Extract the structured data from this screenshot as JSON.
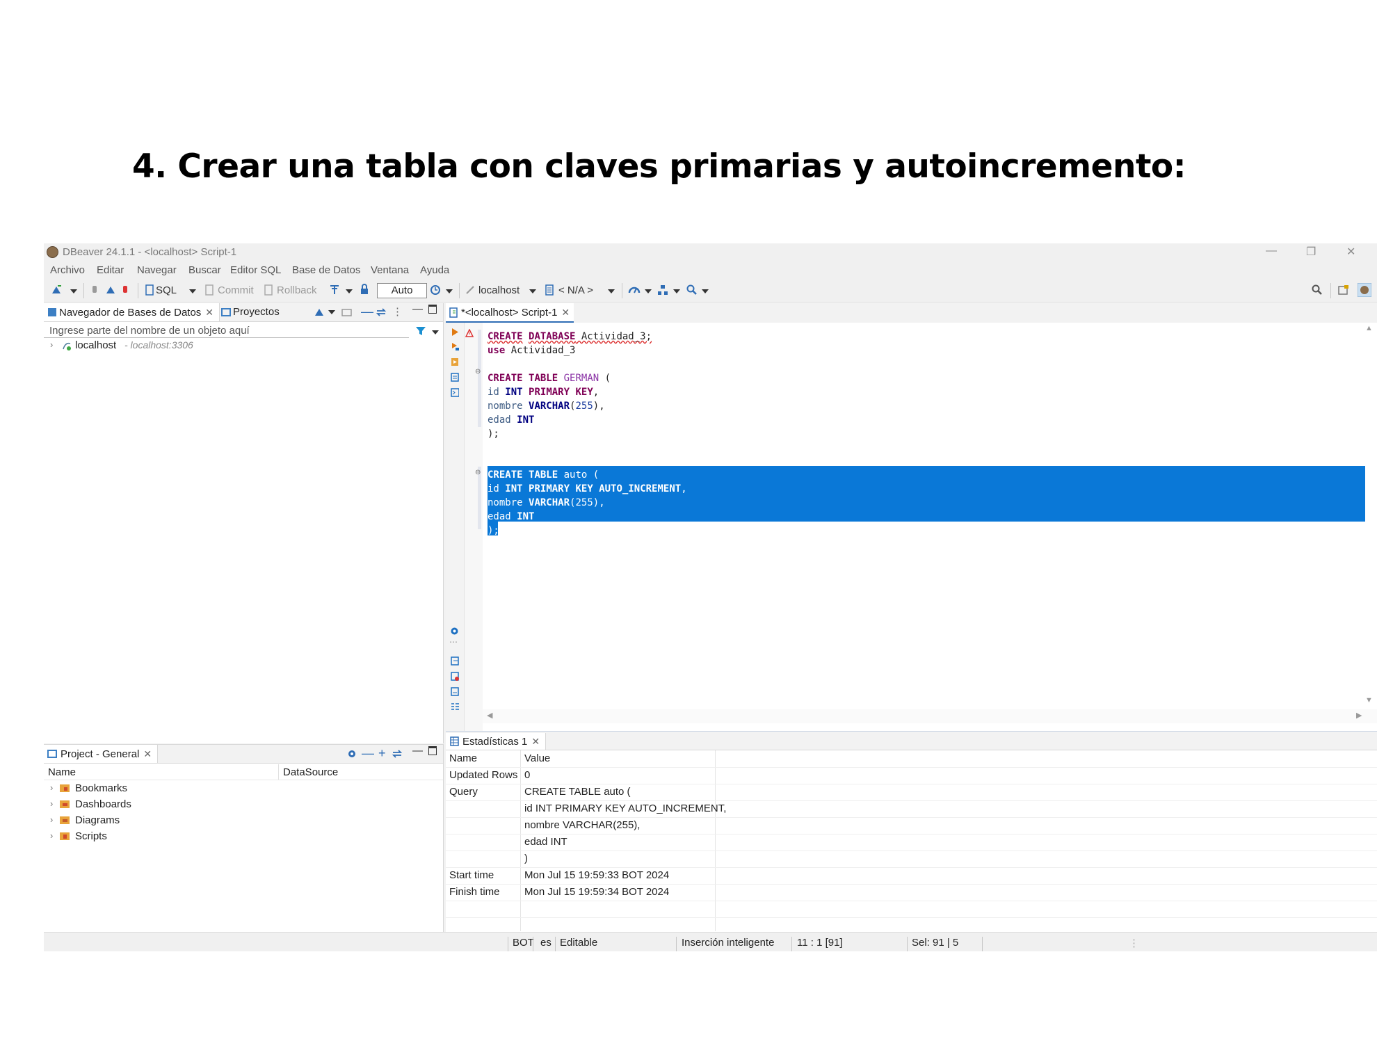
{
  "slide": {
    "title": "4. Crear una tabla con claves primarias y autoincremento:"
  },
  "window": {
    "title": "DBeaver 24.1.1 - <localhost> Script-1",
    "menu": [
      "Archivo",
      "Editar",
      "Navegar",
      "Buscar",
      "Editor SQL",
      "Base de Datos",
      "Ventana",
      "Ayuda"
    ]
  },
  "toolbar": {
    "sql_label": "SQL",
    "commit_label": "Commit",
    "rollback_label": "Rollback",
    "transaction_mode": "Auto",
    "datasource": "localhost",
    "schema": "< N/A >"
  },
  "navigator": {
    "tab_db": "Navegador de Bases de Datos",
    "tab_projects": "Proyectos",
    "filter_placeholder": "Ingrese parte del nombre de un objeto aquí",
    "connection_name": "localhost",
    "connection_host": " - localhost:3306"
  },
  "project": {
    "tab": "Project - General",
    "col_name": "Name",
    "col_datasource": "DataSource",
    "items": [
      "Bookmarks",
      "Dashboards",
      "Diagrams",
      "Scripts"
    ]
  },
  "editor": {
    "tab": "*<localhost> Script-1"
  },
  "results": {
    "tab": "Estadísticas 1",
    "headers": [
      "Name",
      "Value"
    ],
    "rows": [
      [
        "Updated Rows",
        "0"
      ],
      [
        "Query",
        "CREATE TABLE auto ("
      ],
      [
        "",
        "id INT PRIMARY KEY AUTO_INCREMENT,"
      ],
      [
        "",
        "nombre VARCHAR(255),"
      ],
      [
        "",
        "edad INT"
      ],
      [
        "",
        ")"
      ],
      [
        "Start time",
        "Mon Jul 15 19:59:33 BOT 2024"
      ],
      [
        "Finish time",
        "Mon Jul 15 19:59:34 BOT 2024"
      ]
    ]
  },
  "status": {
    "timezone": "BOT",
    "locale": "es",
    "mode": "Editable",
    "insert_mode": "Inserción inteligente",
    "position": "11 : 1 [91]",
    "selection": "Sel: 91 | 5"
  },
  "code": {
    "l1_create": "CREATE",
    "l1_database": "DATABASE",
    "l1_name": " Actividad_3;",
    "l2_use": "use",
    "l2_name": " Actividad_3",
    "t1_create": "CREATE",
    "t1_table": "TABLE",
    "t1_name": "GERMAN",
    "t1_open": " (",
    "c_id": "id",
    "c_int": "INT",
    "c_pk": "PRIMARY KEY",
    "c_comma": ",",
    "c_ai": "AUTO_INCREMENT",
    "c_nombre": "nombre",
    "c_varchar": "VARCHAR",
    "c_paren_open": "(",
    "c_255": "255",
    "c_paren_close": "),",
    "c_edad": "edad",
    "c_close": ");",
    "t2_name": "auto"
  },
  "colors": {
    "selection": "#0a78d7",
    "keyword": "#7f0055",
    "type_keyword": "#000080"
  }
}
